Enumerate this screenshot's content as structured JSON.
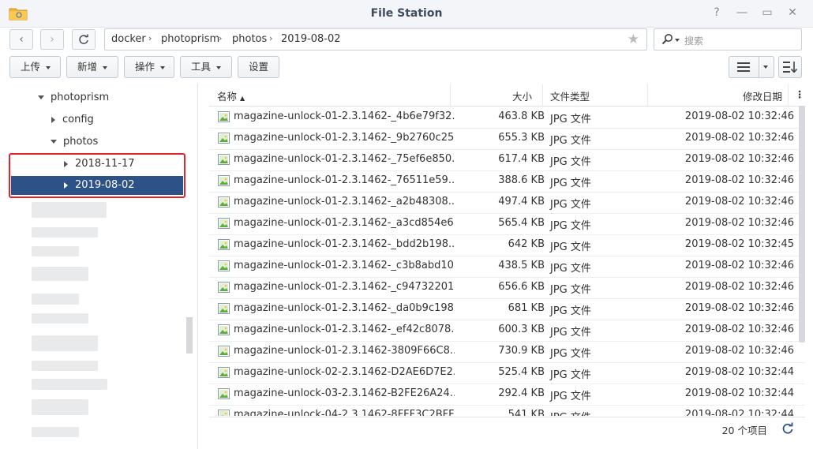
{
  "window": {
    "title": "File Station"
  },
  "nav": {
    "back": "‹",
    "forward": "›"
  },
  "path": {
    "segments": [
      "docker",
      "photoprism",
      "photos",
      "2019-08-02"
    ]
  },
  "search": {
    "placeholder": "搜索"
  },
  "toolbar": {
    "upload": "上传",
    "new": "新增",
    "action": "操作",
    "tools": "工具",
    "settings": "设置"
  },
  "tree": {
    "photoprism": "photoprism",
    "config": "config",
    "photos": "photos",
    "d1": "2018-11-17",
    "d2": "2019-08-02"
  },
  "columns": {
    "name": "名称",
    "size": "大小",
    "type": "文件类型",
    "modified": "修改日期"
  },
  "files": [
    {
      "name": "magazine-unlock-01-2.3.1462-_4b6e79f32...",
      "size": "463.8 KB",
      "type": "JPG 文件",
      "date": "2019-08-02 10:32:46"
    },
    {
      "name": "magazine-unlock-01-2.3.1462-_9b2760c25...",
      "size": "655.3 KB",
      "type": "JPG 文件",
      "date": "2019-08-02 10:32:46"
    },
    {
      "name": "magazine-unlock-01-2.3.1462-_75ef6e850...",
      "size": "617.4 KB",
      "type": "JPG 文件",
      "date": "2019-08-02 10:32:46"
    },
    {
      "name": "magazine-unlock-01-2.3.1462-_76511e59...",
      "size": "388.6 KB",
      "type": "JPG 文件",
      "date": "2019-08-02 10:32:46"
    },
    {
      "name": "magazine-unlock-01-2.3.1462-_a2b48308...",
      "size": "497.4 KB",
      "type": "JPG 文件",
      "date": "2019-08-02 10:32:46"
    },
    {
      "name": "magazine-unlock-01-2.3.1462-_a3cd854e6...",
      "size": "565.4 KB",
      "type": "JPG 文件",
      "date": "2019-08-02 10:32:46"
    },
    {
      "name": "magazine-unlock-01-2.3.1462-_bdd2b198...",
      "size": "642 KB",
      "type": "JPG 文件",
      "date": "2019-08-02 10:32:45"
    },
    {
      "name": "magazine-unlock-01-2.3.1462-_c3b8abd10...",
      "size": "438.5 KB",
      "type": "JPG 文件",
      "date": "2019-08-02 10:32:46"
    },
    {
      "name": "magazine-unlock-01-2.3.1462-_c94732201...",
      "size": "656.6 KB",
      "type": "JPG 文件",
      "date": "2019-08-02 10:32:46"
    },
    {
      "name": "magazine-unlock-01-2.3.1462-_da0b9c198...",
      "size": "681 KB",
      "type": "JPG 文件",
      "date": "2019-08-02 10:32:46"
    },
    {
      "name": "magazine-unlock-01-2.3.1462-_ef42c8078...",
      "size": "600.3 KB",
      "type": "JPG 文件",
      "date": "2019-08-02 10:32:46"
    },
    {
      "name": "magazine-unlock-01-2.3.1462-3809F66C8...",
      "size": "730.9 KB",
      "type": "JPG 文件",
      "date": "2019-08-02 10:32:46"
    },
    {
      "name": "magazine-unlock-02-2.3.1462-D2AE6D7E2...",
      "size": "525.4 KB",
      "type": "JPG 文件",
      "date": "2019-08-02 10:32:44"
    },
    {
      "name": "magazine-unlock-03-2.3.1462-B2FE26A24...",
      "size": "292.4 KB",
      "type": "JPG 文件",
      "date": "2019-08-02 10:32:44"
    },
    {
      "name": "magazine-unlock-04-2.3.1462-8FFF3C2BFF...",
      "size": "541 KB",
      "type": "JPG 文件",
      "date": "2019-08-02 10:32:44"
    }
  ],
  "footer": {
    "count": "20 个项目"
  }
}
